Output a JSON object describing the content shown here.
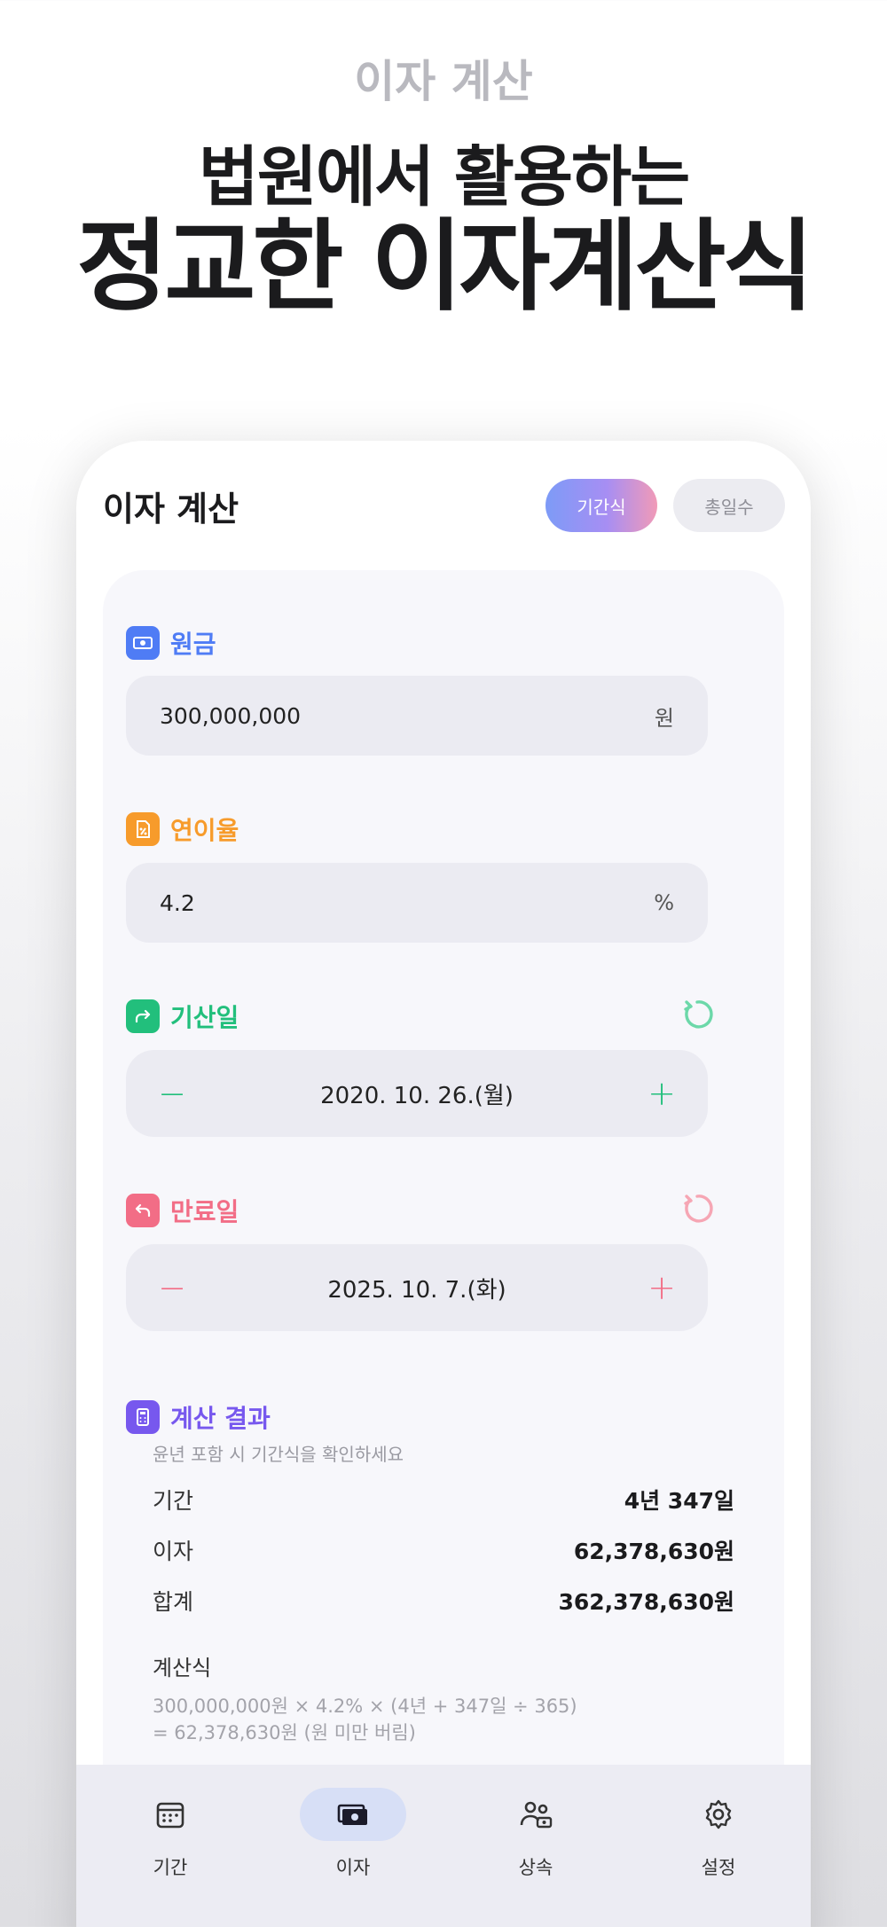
{
  "hero": {
    "subtitle": "이자 계산",
    "headline_line1": "법원에서 활용하는",
    "headline_line2": "정교한 이자계산식"
  },
  "header": {
    "title": "이자 계산",
    "mode_tabs": [
      {
        "label": "기간식",
        "selected": true
      },
      {
        "label": "총일수",
        "selected": false
      }
    ]
  },
  "principal": {
    "label": "원금",
    "value": "300,000,000",
    "unit": "원",
    "color": "#4f7cf5"
  },
  "rate": {
    "label": "연이율",
    "value": "4.2",
    "unit": "%",
    "color": "#f79b2b"
  },
  "start_date": {
    "label": "기산일",
    "value": "2020. 10. 26.(월)",
    "minus": "−",
    "plus": "+",
    "color": "#22bf7c"
  },
  "end_date": {
    "label": "만료일",
    "value": "2025. 10. 7.(화)",
    "minus": "−",
    "plus": "+",
    "color": "#f26d86"
  },
  "result": {
    "label": "계산 결과",
    "subtitle": "윤년 포함 시 기간식을 확인하세요",
    "color": "#7758ee",
    "rows": [
      {
        "key": "기간",
        "value": "4년 347일"
      },
      {
        "key": "이자",
        "value": "62,378,630원"
      },
      {
        "key": "합계",
        "value": "362,378,630원"
      }
    ],
    "formula_title": "계산식",
    "formula_line1": "300,000,000원 × 4.2% × (4년 + 347일 ÷ 365)",
    "formula_line2": "= 62,378,630원 (원 미만 버림)"
  },
  "tabbar": {
    "items": [
      {
        "label": "기간",
        "icon": "calendar-icon",
        "active": false
      },
      {
        "label": "이자",
        "icon": "money-icon",
        "active": true
      },
      {
        "label": "상속",
        "icon": "people-money-icon",
        "active": false
      },
      {
        "label": "설정",
        "icon": "gear-icon",
        "active": false
      }
    ]
  }
}
